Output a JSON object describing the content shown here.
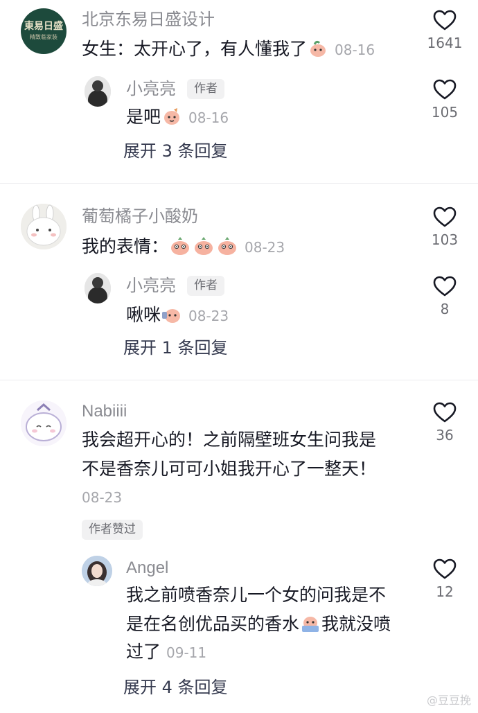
{
  "comments": [
    {
      "user": "北京东易日盛设计",
      "avatar_text_top": "東易日盛",
      "avatar_text_bottom": "精致临家装",
      "text": "女生：太开心了，有人懂我了",
      "date": "08-16",
      "likes": "1641",
      "reply": {
        "user": "小亮亮",
        "badge": "作者",
        "text": "是吧",
        "date": "08-16",
        "likes": "105"
      },
      "expand": "展开 3 条回复"
    },
    {
      "user": "葡萄橘子小酸奶",
      "text": "我的表情：",
      "date": "08-23",
      "likes": "103",
      "reply": {
        "user": "小亮亮",
        "badge": "作者",
        "text": "啾咪",
        "date": "08-23",
        "likes": "8"
      },
      "expand": "展开 1 条回复"
    },
    {
      "user": "Nabiiii",
      "text_line1": "我会超开心的！之前隔壁班女生问我是",
      "text_line2": "不是香奈儿可可小姐我开心了一整天！",
      "date": "08-23",
      "likes": "36",
      "liked_badge": "作者赞过",
      "reply": {
        "user": "Angel",
        "text_line1": "我之前喷香奈儿一个女的问我是不",
        "text_line2a": "是在名创优品买的香水",
        "text_line2b": "我就没喷",
        "text_line3": "过了",
        "date": "09-11",
        "likes": "12"
      },
      "expand": "展开 4 条回复"
    }
  ],
  "watermark": "@豆豆挽",
  "icons": {
    "heart": "heart-outline-icon",
    "emoji": "peach-face-emoji"
  },
  "colors": {
    "text": "#161823",
    "secondary": "#8a8b91",
    "date": "#a5a6ab",
    "expand": "#34394e",
    "avatar_green": "#1d4a3c"
  }
}
